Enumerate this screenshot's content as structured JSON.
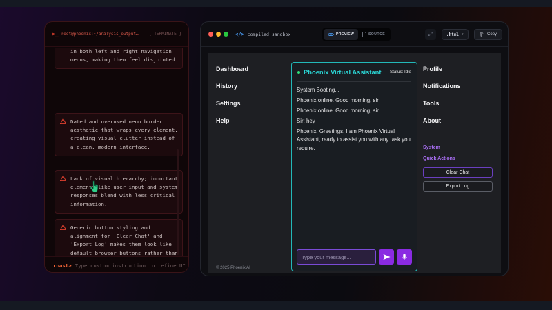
{
  "terminal": {
    "path": "root@phoenix:~/analysis_output…",
    "terminate_label": "[ TERMINATE ]",
    "issues": [
      {
        "text": "in both left and right navigation menus, making them feel disjointed."
      },
      {
        "text": "Dated and overused neon border aesthetic that wraps every element, creating visual clutter instead of a clean, modern interface."
      },
      {
        "text": "Lack of visual hierarchy; important elements like user input and system responses blend with less critical information."
      },
      {
        "text": "Generic button styling and alignment for 'Clear Chat' and 'Export Log' makes them look like default browser buttons rather than integrated UI components."
      }
    ],
    "prompt_label": "roast>",
    "input_placeholder": "Type custom instruction to refine UI (",
    "colors": {
      "accent": "#e0402e",
      "prompt": "#ff6a3a"
    }
  },
  "sandbox": {
    "file_title": "compiled_sandbox",
    "tabs": [
      {
        "label": "PREVIEW",
        "active": true
      },
      {
        "label": "SOURCE",
        "active": false
      }
    ],
    "format_select": ".html",
    "copy_label": "Copy"
  },
  "app": {
    "left_nav": [
      "Dashboard",
      "History",
      "Settings",
      "Help"
    ],
    "right_nav": [
      "Profile",
      "Notifications",
      "Tools",
      "About"
    ],
    "footer": "© 2025 Phoenix AI",
    "chat": {
      "title": "Phoenix Virtual Assistant",
      "status": "Status: Idle",
      "messages": [
        "System Booting...",
        "Phoenix online. Good morning, sir.",
        "Phoenix online. Good morning, sir.",
        "Sir: hey",
        "Phoenix: Greetings. I am Phoenix Virtual Assistant, ready to assist you with any task you require."
      ],
      "input_placeholder": "Type your message...",
      "colors": {
        "border": "#22b8b8",
        "title": "#2ad4d4",
        "button": "#8a2be2"
      }
    },
    "system_label": "System",
    "quick_actions_label": "Quick Actions",
    "clear_chat_label": "Clear Chat",
    "export_log_label": "Export Log"
  }
}
